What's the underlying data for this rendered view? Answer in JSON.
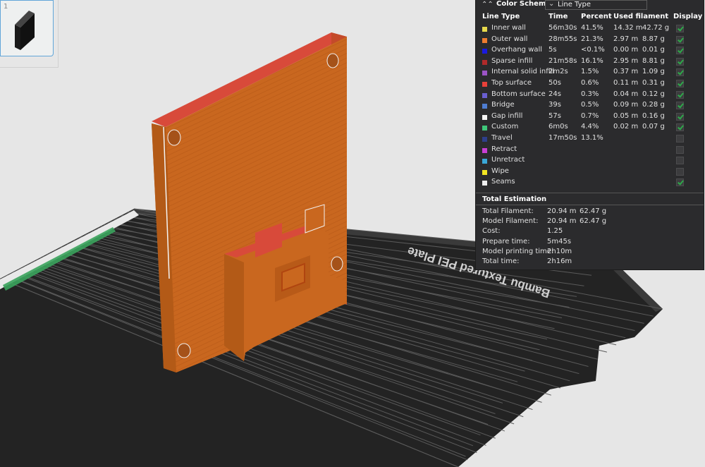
{
  "plate": {
    "number": "1",
    "bed_label": "Bambu Textured PEI Plate"
  },
  "colors": {
    "model": "#c9671f",
    "model_top": "#d84a3a",
    "bed": "#2a2a2a",
    "panel": "#2b2b2d",
    "check": "#2ea84a"
  },
  "legend": {
    "title": "Color Scheme",
    "scheme": "Line Type",
    "headers": {
      "type": "Line Type",
      "time": "Time",
      "percent": "Percent",
      "filament": "Used filament",
      "display": "Display"
    },
    "rows": [
      {
        "label": "Inner wall",
        "color": "#e7d94c",
        "time": "56m30s",
        "percent": "41.5%",
        "length": "14.32 m",
        "weight": "42.72 g",
        "display": true
      },
      {
        "label": "Outer wall",
        "color": "#ef7c2f",
        "time": "28m55s",
        "percent": "21.3%",
        "length": "2.97 m",
        "weight": "8.87 g",
        "display": true
      },
      {
        "label": "Overhang wall",
        "color": "#1a1ae0",
        "time": "5s",
        "percent": "<0.1%",
        "length": "0.00 m",
        "weight": "0.01 g",
        "display": true
      },
      {
        "label": "Sparse infill",
        "color": "#b02a2a",
        "time": "21m58s",
        "percent": "16.1%",
        "length": "2.95 m",
        "weight": "8.81 g",
        "display": true
      },
      {
        "label": "Internal solid infill",
        "color": "#9c54c6",
        "time": "2m2s",
        "percent": "1.5%",
        "length": "0.37 m",
        "weight": "1.09 g",
        "display": true
      },
      {
        "label": "Top surface",
        "color": "#e8403a",
        "time": "50s",
        "percent": "0.6%",
        "length": "0.11 m",
        "weight": "0.31 g",
        "display": true
      },
      {
        "label": "Bottom surface",
        "color": "#6a5fd1",
        "time": "24s",
        "percent": "0.3%",
        "length": "0.04 m",
        "weight": "0.12 g",
        "display": true
      },
      {
        "label": "Bridge",
        "color": "#4e7dd2",
        "time": "39s",
        "percent": "0.5%",
        "length": "0.09 m",
        "weight": "0.28 g",
        "display": true
      },
      {
        "label": "Gap infill",
        "color": "#f5f5f5",
        "time": "57s",
        "percent": "0.7%",
        "length": "0.05 m",
        "weight": "0.16 g",
        "display": true
      },
      {
        "label": "Custom",
        "color": "#3fc77a",
        "time": "6m0s",
        "percent": "4.4%",
        "length": "0.02 m",
        "weight": "0.07 g",
        "display": true
      },
      {
        "label": "Travel",
        "color": "#2e3f8a",
        "time": "17m50s",
        "percent": "13.1%",
        "length": "",
        "weight": "",
        "display": false
      },
      {
        "label": "Retract",
        "color": "#c93fd4",
        "time": "",
        "percent": "",
        "length": "",
        "weight": "",
        "display": false
      },
      {
        "label": "Unretract",
        "color": "#3aa8d8",
        "time": "",
        "percent": "",
        "length": "",
        "weight": "",
        "display": false
      },
      {
        "label": "Wipe",
        "color": "#f2e522",
        "time": "",
        "percent": "",
        "length": "",
        "weight": "",
        "display": false
      },
      {
        "label": "Seams",
        "color": "#eeeeee",
        "time": "",
        "percent": "",
        "length": "",
        "weight": "",
        "display": true
      }
    ]
  },
  "totals": {
    "title": "Total Estimation",
    "rows": [
      {
        "label": "Total Filament:",
        "v1": "20.94 m",
        "v2": "62.47 g"
      },
      {
        "label": "Model Filament:",
        "v1": "20.94 m",
        "v2": "62.47 g"
      },
      {
        "label": "Cost:",
        "v1": "1.25",
        "v2": ""
      },
      {
        "label": "Prepare time:",
        "v1": "5m45s",
        "v2": ""
      },
      {
        "label": "Model printing time:",
        "v1": "2h10m",
        "v2": ""
      },
      {
        "label": "Total time:",
        "v1": "2h16m",
        "v2": ""
      }
    ]
  }
}
